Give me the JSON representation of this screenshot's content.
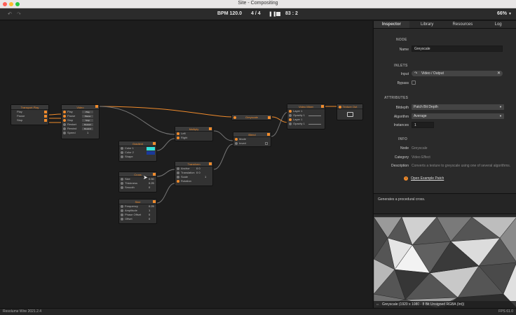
{
  "window": {
    "title": "Site - Compositing"
  },
  "toolbar": {
    "bpm": "BPM 120.0",
    "time_sig": "4 / 4",
    "position": "83 : 2",
    "zoom": "66%"
  },
  "nodes": {
    "transport": {
      "title": "Transport Play",
      "rows": [
        "Play",
        "Pause",
        "Stop"
      ]
    },
    "video": {
      "title": "Video",
      "rows": [
        "Play",
        "Pause",
        "Stop",
        "Restart",
        "Rewind",
        "Speed"
      ],
      "buttons": [
        "Play",
        "Pause",
        "Stop",
        "Restart",
        "Rewind"
      ],
      "speed": "1"
    },
    "gradient": {
      "title": "Gradient",
      "rows": [
        "Color 1",
        "Color 2",
        "Shape"
      ]
    },
    "multiply": {
      "title": "Multiply",
      "rows": [
        "Left",
        "Right"
      ]
    },
    "cross": {
      "title": "Cross",
      "rows": [
        "Size",
        "Thickness",
        "Smooth"
      ],
      "values": [
        "0.50",
        "0.25",
        "0"
      ]
    },
    "sine": {
      "title": "Sine",
      "rows": [
        "Frequency",
        "Amplitude",
        "Phase Offset",
        "Offset"
      ],
      "values": [
        "0.25",
        "1",
        "0",
        "0"
      ]
    },
    "transform": {
      "title": "Transform",
      "rows": [
        "Anchor",
        "Translation",
        "Scale",
        "Rotation"
      ],
      "values": [
        "0  0",
        "0  0",
        "1",
        ""
      ]
    },
    "greyscale": {
      "title": "Greyscale"
    },
    "blend": {
      "title": "Blend",
      "rows": [
        "Mode",
        "Invert"
      ]
    },
    "video_mixer": {
      "title": "Video Mixer",
      "rows": [
        "Layer 1",
        "Opacity 1",
        "Layer 1",
        "Opacity 1"
      ]
    },
    "texture_out": {
      "title": "Texture Out"
    }
  },
  "inspector": {
    "tabs": [
      "Inspector",
      "Library",
      "Resources",
      "Log"
    ],
    "node_section": "NODE",
    "name_label": "Name",
    "name_value": "Greyscale",
    "inlets_section": "INLETS",
    "input_label": "Input",
    "input_value": "Video / Output",
    "bypass_label": "Bypass",
    "attributes_section": "ATTRIBUTES",
    "bitdepth_label": "Bitdepth",
    "bitdepth_value": "Patch Bit Depth",
    "algorithm_label": "Algorithm",
    "algorithm_value": "Average",
    "instances_label": "Instances",
    "instances_value": "1",
    "info_section": "INFO",
    "info_node_label": "Node",
    "info_node_value": "Greyscale",
    "category_label": "Category",
    "category_value": "Video Effect",
    "description_label": "Description",
    "description_value": "Converts a texture to greyscale using one of several algorithms.",
    "example_link": "Open Example Patch",
    "desc_box": "Generates a procedural cross.",
    "preview_caption": "Greyscale (1920 x 1080 - 8 Bit Unsigned RGBA (Int))"
  },
  "status": {
    "app": "Resolume Wire 2021.2.4",
    "fps": "FPS 61.0"
  },
  "colors": {
    "accent": "#f08b2c",
    "canvas": "#1d1d1d",
    "panel": "#2a2a2a"
  }
}
